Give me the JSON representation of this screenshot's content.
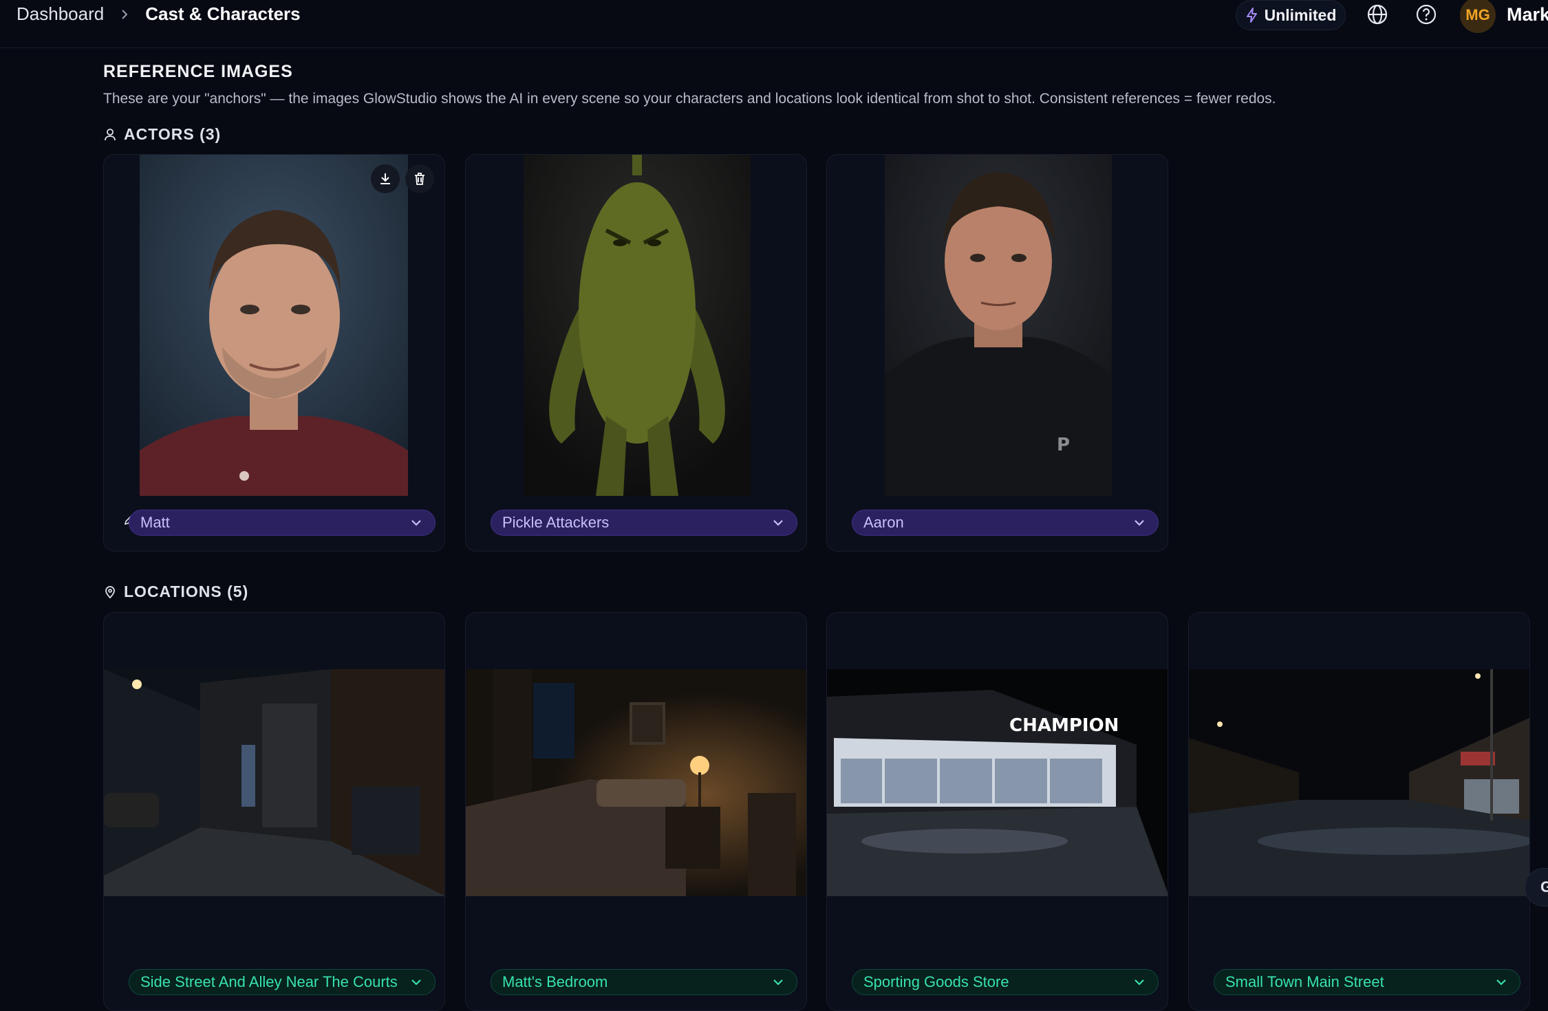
{
  "breadcrumb": {
    "parent": "Dashboard",
    "current": "Cast & Characters"
  },
  "header": {
    "plan_label": "Unlimited",
    "avatar_initials": "MG",
    "user_name": "Mark",
    "icons": [
      "lightning-icon",
      "globe-icon",
      "help-icon"
    ]
  },
  "reference": {
    "title": "REFERENCE IMAGES",
    "description": "These are your \"anchors\" — the images GlowStudio shows the AI in every scene so your characters and locations look identical from shot to shot. Consistent references = fewer redos."
  },
  "actors": {
    "heading": "ACTORS (3)",
    "items": [
      {
        "name": "Matt"
      },
      {
        "name": "Pickle Attackers"
      },
      {
        "name": "Aaron"
      }
    ]
  },
  "locations": {
    "heading": "LOCATIONS (5)",
    "items": [
      {
        "name": "Side Street And Alley Near The Courts"
      },
      {
        "name": "Matt's Bedroom"
      },
      {
        "name": "Sporting Goods Store"
      },
      {
        "name": "Small Town Main Street"
      }
    ]
  },
  "store_sign": "CHAMPION",
  "edge_tab_label": "G",
  "colors": {
    "background": "#070a13",
    "actor_pill": "#2b2160",
    "actor_text": "#cbbefc",
    "location_pill": "#07211c",
    "location_text": "#38e1b0",
    "avatar": "#f0a424"
  }
}
